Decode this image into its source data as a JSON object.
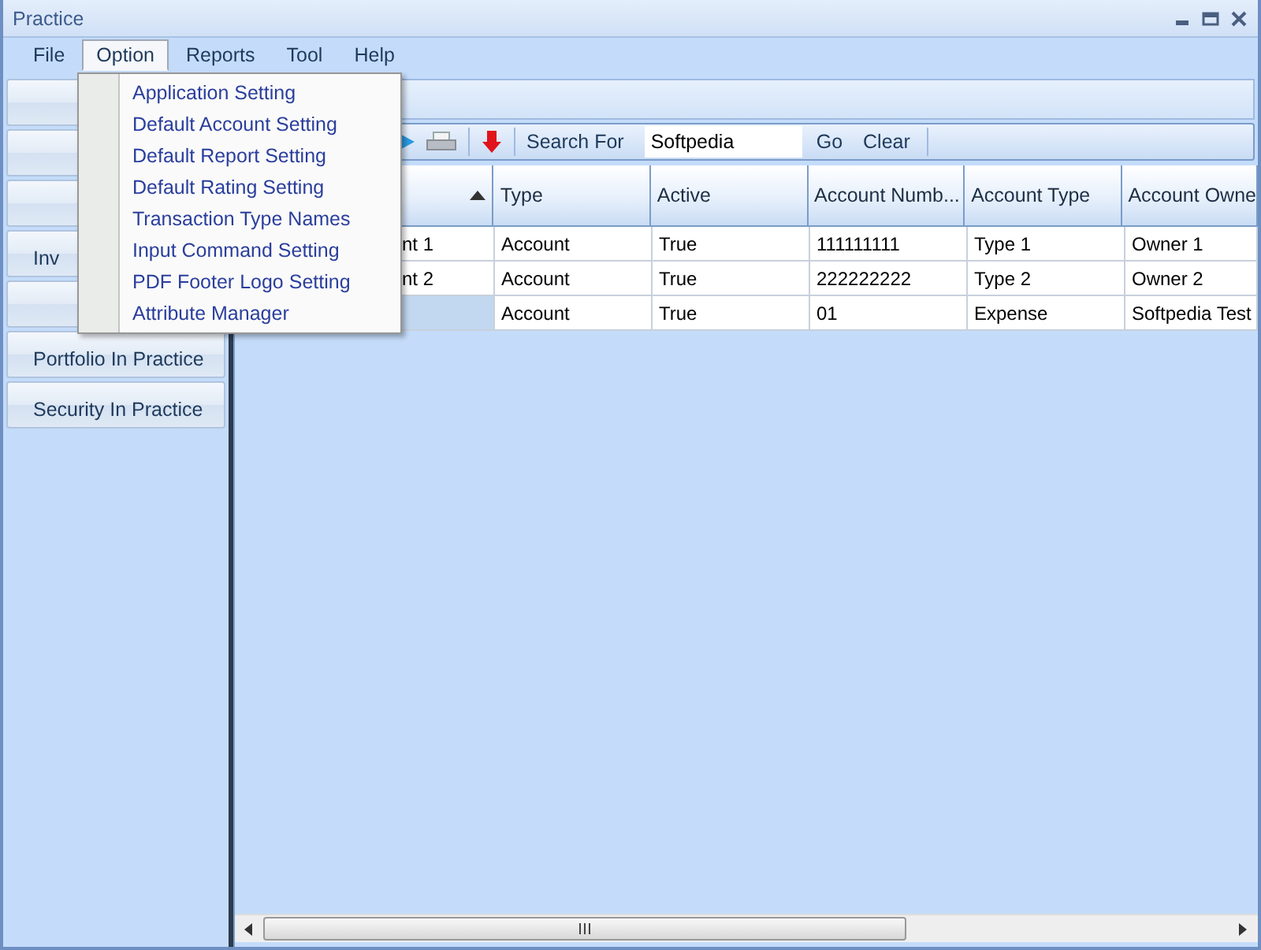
{
  "window": {
    "title": "Practice"
  },
  "menu_bar": [
    {
      "label": "File",
      "expanded": false
    },
    {
      "label": "Option",
      "expanded": true
    },
    {
      "label": "Reports",
      "expanded": false
    },
    {
      "label": "Tool",
      "expanded": false
    },
    {
      "label": "Help",
      "expanded": false
    }
  ],
  "dropdown": [
    "Application Setting",
    "Default Account Setting",
    "Default Report Setting",
    "Default Rating Setting",
    "Transaction Type Names",
    "Input Command Setting",
    "PDF Footer Logo Setting",
    "Attribute Manager"
  ],
  "sidebar": {
    "buttons": [
      {
        "kind": "button"
      },
      {
        "kind": "button"
      },
      {
        "kind": "button"
      },
      {
        "kind": "button",
        "label": "Inv"
      },
      {
        "kind": "button"
      },
      {
        "kind": "button",
        "label": "Portfolio In Practice"
      },
      {
        "kind": "button",
        "label": "Security In Practice"
      }
    ]
  },
  "toolbar": {
    "search_label": "Search For",
    "search_value": "Softpedia",
    "buttons": [
      "Go",
      "Clear"
    ]
  },
  "table": {
    "columns": [
      {
        "sorted": true
      },
      {
        "label": "Type",
        "sorted": false
      },
      {
        "label": "Active",
        "sorted": false
      },
      {
        "label": "Account Numb...",
        "sorted": false
      },
      {
        "label": "Account Type",
        "sorted": false
      },
      {
        "label": "Account Owne",
        "sorted": false
      }
    ],
    "rows": [
      {
        "selected": false,
        "cells": [
          "nt 1",
          "Account",
          "True",
          "111111111",
          "Type 1",
          "Owner 1"
        ]
      },
      {
        "selected": false,
        "cells": [
          "nt 2",
          "Account",
          "True",
          "222222222",
          "Type 2",
          "Owner 2"
        ]
      },
      {
        "selected": true,
        "cells": [
          null,
          "Account",
          "True",
          "01",
          "Expense",
          "Softpedia Test"
        ]
      }
    ]
  }
}
